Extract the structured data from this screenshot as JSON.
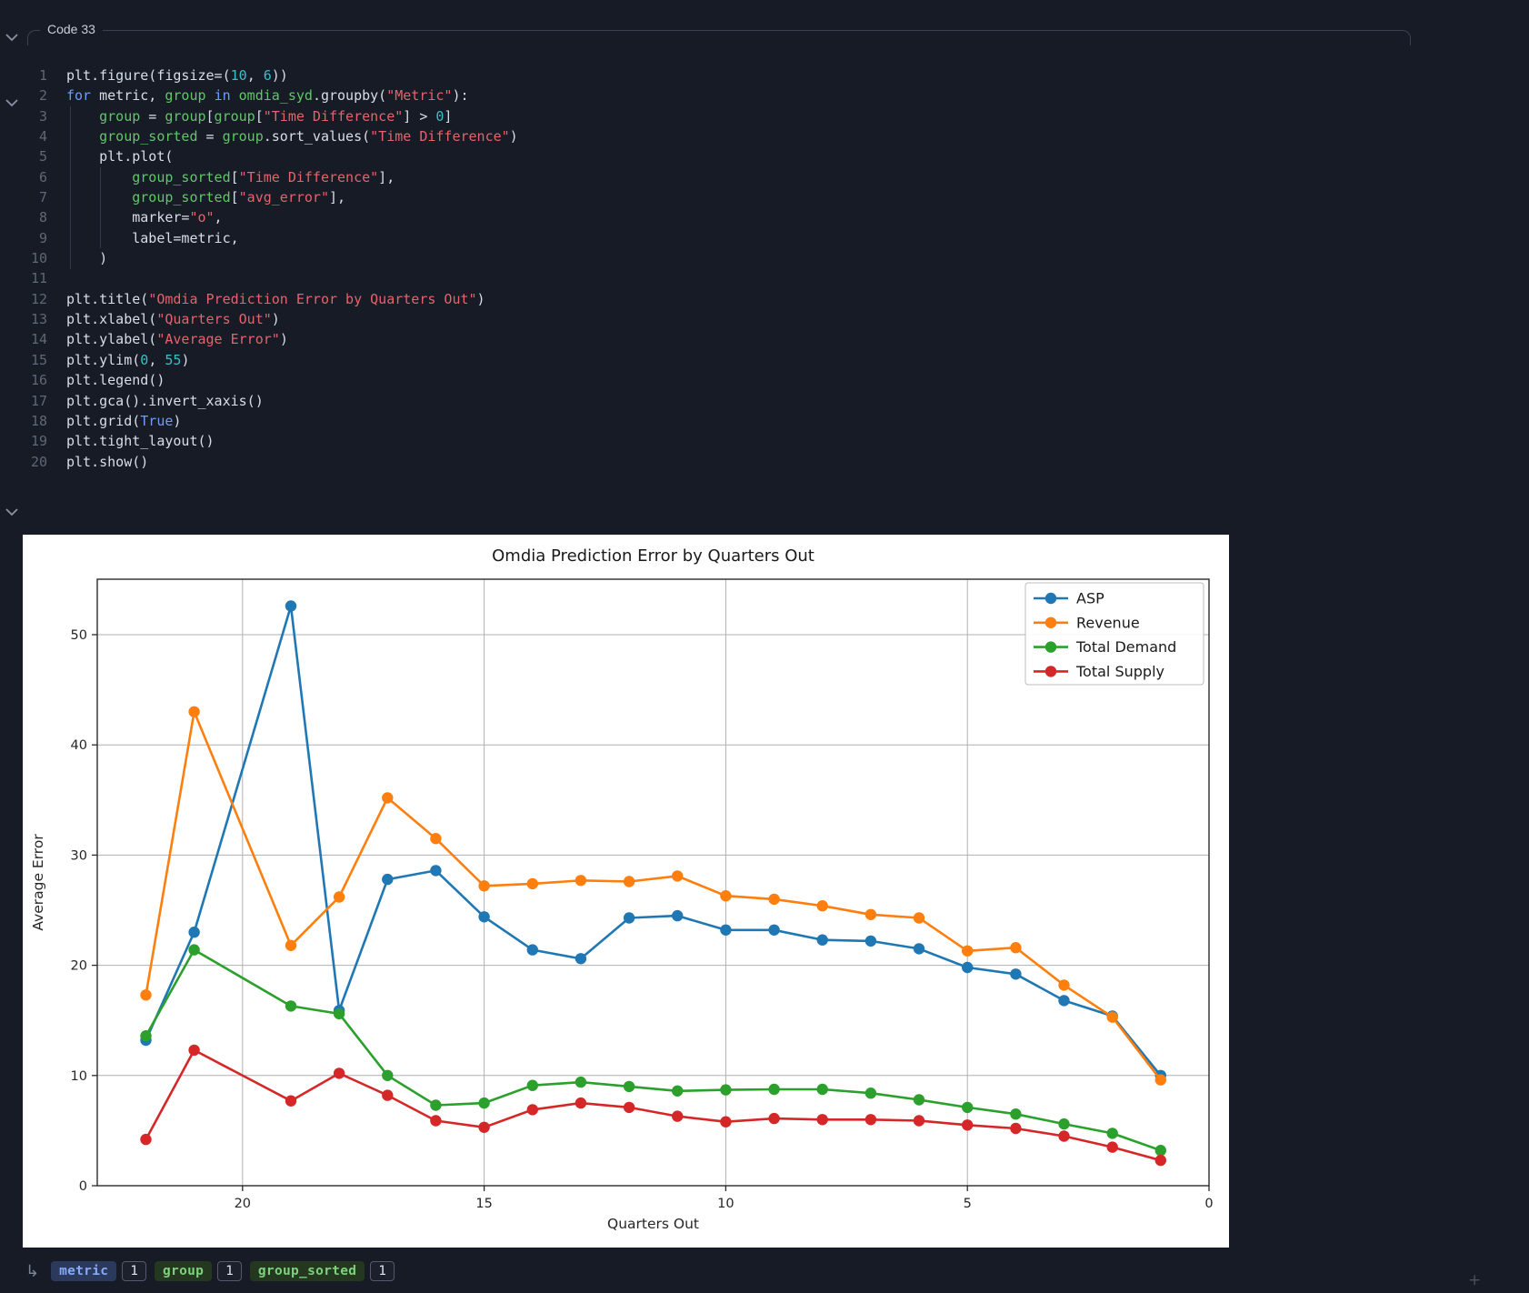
{
  "cell": {
    "label": "Code 33"
  },
  "icons": {
    "return_arrow": "↳",
    "plus": "+"
  },
  "code": {
    "lines": [
      {
        "num": "1",
        "indent": 0,
        "segs": [
          [
            "d",
            "plt.figure(figsize=("
          ],
          [
            "n",
            "10"
          ],
          [
            "d",
            ", "
          ],
          [
            "n",
            "6"
          ],
          [
            "d",
            "))"
          ]
        ]
      },
      {
        "num": "2",
        "indent": 0,
        "segs": [
          [
            "k",
            "for"
          ],
          [
            "d",
            " metric, "
          ],
          [
            "g",
            "group"
          ],
          [
            "d",
            " "
          ],
          [
            "k",
            "in"
          ],
          [
            "d",
            " "
          ],
          [
            "g",
            "omdia_syd"
          ],
          [
            "d",
            ".groupby("
          ],
          [
            "s",
            "\"Metric\""
          ],
          [
            "d",
            "):"
          ]
        ]
      },
      {
        "num": "3",
        "indent": 4,
        "segs": [
          [
            "g",
            "group"
          ],
          [
            "d",
            " = "
          ],
          [
            "g",
            "group"
          ],
          [
            "d",
            "["
          ],
          [
            "g",
            "group"
          ],
          [
            "d",
            "["
          ],
          [
            "s",
            "\"Time Difference\""
          ],
          [
            "d",
            "] > "
          ],
          [
            "n",
            "0"
          ],
          [
            "d",
            "]"
          ]
        ]
      },
      {
        "num": "4",
        "indent": 4,
        "segs": [
          [
            "g",
            "group_sorted"
          ],
          [
            "d",
            " = "
          ],
          [
            "g",
            "group"
          ],
          [
            "d",
            ".sort_values("
          ],
          [
            "s",
            "\"Time Difference\""
          ],
          [
            "d",
            ")"
          ]
        ]
      },
      {
        "num": "5",
        "indent": 4,
        "segs": [
          [
            "d",
            "plt.plot("
          ]
        ]
      },
      {
        "num": "6",
        "indent": 8,
        "segs": [
          [
            "g",
            "group_sorted"
          ],
          [
            "d",
            "["
          ],
          [
            "s",
            "\"Time Difference\""
          ],
          [
            "d",
            "],"
          ]
        ]
      },
      {
        "num": "7",
        "indent": 8,
        "segs": [
          [
            "g",
            "group_sorted"
          ],
          [
            "d",
            "["
          ],
          [
            "s",
            "\"avg_error\""
          ],
          [
            "d",
            "],"
          ]
        ]
      },
      {
        "num": "8",
        "indent": 8,
        "segs": [
          [
            "d",
            "marker="
          ],
          [
            "s",
            "\"o\""
          ],
          [
            "d",
            ","
          ]
        ]
      },
      {
        "num": "9",
        "indent": 8,
        "segs": [
          [
            "d",
            "label=metric,"
          ]
        ]
      },
      {
        "num": "10",
        "indent": 4,
        "segs": [
          [
            "d",
            ")"
          ]
        ]
      },
      {
        "num": "11",
        "indent": 0,
        "segs": []
      },
      {
        "num": "12",
        "indent": 0,
        "segs": [
          [
            "d",
            "plt.title("
          ],
          [
            "s",
            "\"Omdia Prediction Error by Quarters Out\""
          ],
          [
            "d",
            ")"
          ]
        ]
      },
      {
        "num": "13",
        "indent": 0,
        "segs": [
          [
            "d",
            "plt.xlabel("
          ],
          [
            "s",
            "\"Quarters Out\""
          ],
          [
            "d",
            ")"
          ]
        ]
      },
      {
        "num": "14",
        "indent": 0,
        "segs": [
          [
            "d",
            "plt.ylabel("
          ],
          [
            "s",
            "\"Average Error\""
          ],
          [
            "d",
            ")"
          ]
        ]
      },
      {
        "num": "15",
        "indent": 0,
        "segs": [
          [
            "d",
            "plt.ylim("
          ],
          [
            "n",
            "0"
          ],
          [
            "d",
            ", "
          ],
          [
            "n",
            "55"
          ],
          [
            "d",
            ")"
          ]
        ]
      },
      {
        "num": "16",
        "indent": 0,
        "segs": [
          [
            "d",
            "plt.legend()"
          ]
        ]
      },
      {
        "num": "17",
        "indent": 0,
        "segs": [
          [
            "d",
            "plt.gca().invert_xaxis()"
          ]
        ]
      },
      {
        "num": "18",
        "indent": 0,
        "segs": [
          [
            "d",
            "plt.grid("
          ],
          [
            "k",
            "True"
          ],
          [
            "d",
            ")"
          ]
        ]
      },
      {
        "num": "19",
        "indent": 0,
        "segs": [
          [
            "d",
            "plt.tight_layout()"
          ]
        ]
      },
      {
        "num": "20",
        "indent": 0,
        "segs": [
          [
            "d",
            "plt.show()"
          ]
        ]
      }
    ]
  },
  "chart_data": {
    "type": "line",
    "title": "Omdia Prediction Error by Quarters Out",
    "xlabel": "Quarters Out",
    "ylabel": "Average Error",
    "ylim": [
      0,
      55
    ],
    "x_ticks": [
      20,
      15,
      10,
      5,
      0
    ],
    "y_ticks": [
      0,
      10,
      20,
      30,
      40,
      50
    ],
    "x_axis_inverted": true,
    "grid": true,
    "legend_position": "upper right",
    "marker": "o",
    "x": [
      22,
      21,
      19,
      18,
      17,
      16,
      15,
      14,
      13,
      12,
      11,
      10,
      9,
      8,
      7,
      6,
      5,
      4,
      3,
      2,
      1
    ],
    "series": [
      {
        "name": "ASP",
        "color": "#1f77b4",
        "values": [
          13.2,
          23.0,
          52.6,
          15.9,
          27.8,
          28.6,
          24.4,
          21.4,
          20.6,
          24.3,
          24.5,
          23.2,
          23.2,
          22.3,
          22.2,
          21.5,
          19.8,
          19.2,
          16.8,
          15.4,
          10.0
        ]
      },
      {
        "name": "Revenue",
        "color": "#ff7f0e",
        "values": [
          17.3,
          43.0,
          21.8,
          26.2,
          35.2,
          31.5,
          27.2,
          27.4,
          27.7,
          27.6,
          28.1,
          26.3,
          26.0,
          25.4,
          24.6,
          24.3,
          21.3,
          21.6,
          18.2,
          15.3,
          9.6
        ]
      },
      {
        "name": "Total Demand",
        "color": "#2ca02c",
        "values": [
          13.6,
          21.4,
          16.3,
          15.6,
          10.0,
          7.3,
          7.5,
          9.1,
          9.4,
          9.0,
          8.6,
          8.7,
          8.75,
          8.75,
          8.4,
          7.8,
          7.1,
          6.5,
          5.6,
          4.75,
          3.2
        ]
      },
      {
        "name": "Total Supply",
        "color": "#d62728",
        "values": [
          4.2,
          12.3,
          7.7,
          10.2,
          8.2,
          5.9,
          5.3,
          6.9,
          7.5,
          7.1,
          6.3,
          5.8,
          6.1,
          6.0,
          6.0,
          5.9,
          5.5,
          5.2,
          4.5,
          3.5,
          2.3
        ]
      }
    ],
    "plot_colors": {
      "spine": "#2b2b2b",
      "grid": "#b0b0b0",
      "text": "#262626",
      "background": "#ffffff"
    }
  },
  "status_bar": {
    "badges": [
      {
        "label": "metric",
        "count": "1",
        "type": "blue"
      },
      {
        "label": "group",
        "count": "1",
        "type": "green"
      },
      {
        "label": "group_sorted",
        "count": "1",
        "type": "green"
      }
    ]
  }
}
